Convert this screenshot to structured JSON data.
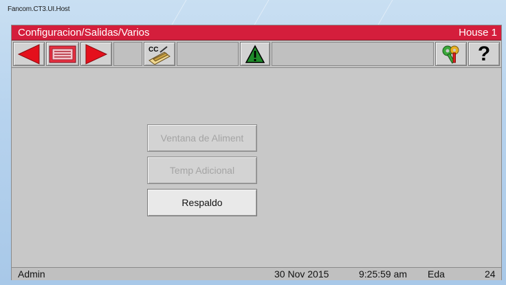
{
  "window": {
    "title": "Fancom.CT3.UI.Host"
  },
  "header": {
    "breadcrumb": "Configuracion/Salidas/Varios",
    "house": "House 1",
    "color": "#d41e3c"
  },
  "toolbar": {
    "prev": {
      "icon": "arrow-left-icon"
    },
    "list": {
      "icon": "list-icon"
    },
    "next": {
      "icon": "arrow-right-icon"
    },
    "cc": {
      "label": "CC",
      "icon": "cc-tool-icon"
    },
    "alarm": {
      "icon": "warning-icon"
    },
    "keys": {
      "icon": "keys-icon"
    },
    "help": {
      "label": "?",
      "icon": "help-icon"
    }
  },
  "menu": {
    "items": [
      {
        "label": "Ventana de Aliment",
        "enabled": false
      },
      {
        "label": "Temp Adicional",
        "enabled": false
      },
      {
        "label": "Respaldo",
        "enabled": true
      }
    ]
  },
  "status": {
    "user": "Admin",
    "date": "30 Nov 2015",
    "time": "9:25:59 am",
    "mode": "Eda",
    "number": "24"
  }
}
